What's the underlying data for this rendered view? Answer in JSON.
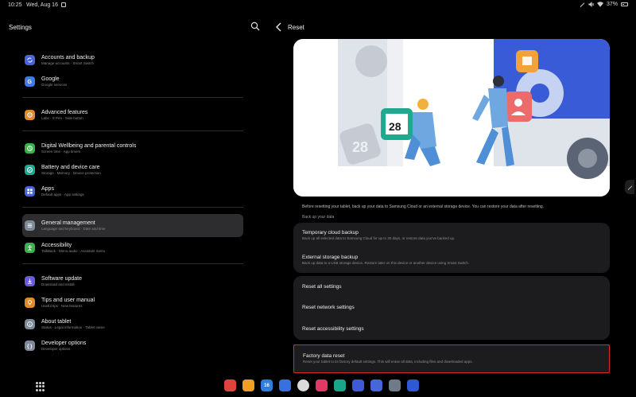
{
  "status_bar": {
    "time": "10:25",
    "date": "Wed, Aug 16",
    "battery": "37%"
  },
  "left": {
    "title": "Settings",
    "groups": [
      [
        {
          "title": "Accounts and backup",
          "sub": "Manage accounts · Smart Switch",
          "color": "#4a63d8",
          "icon": "sync-icon"
        },
        {
          "title": "Google",
          "sub": "Google services",
          "color": "#3d7be8",
          "icon": "google-icon"
        }
      ],
      [
        {
          "title": "Advanced features",
          "sub": "Labs · S Pen · Side button",
          "color": "#e08a2b",
          "icon": "star-gear-icon"
        }
      ],
      [
        {
          "title": "Digital Wellbeing and parental controls",
          "sub": "Screen time · App timers",
          "color": "#3bb14a",
          "icon": "wellbeing-icon"
        },
        {
          "title": "Battery and device care",
          "sub": "Storage · Memory · Device protection",
          "color": "#1fa98f",
          "icon": "device-care-icon"
        },
        {
          "title": "Apps",
          "sub": "Default apps · App settings",
          "color": "#4a63d8",
          "icon": "apps-icon"
        }
      ],
      [
        {
          "title": "General management",
          "sub": "Language and keyboard · Date and time",
          "color": "#7f8a98",
          "icon": "sliders-icon",
          "selected": true
        },
        {
          "title": "Accessibility",
          "sub": "TalkBack · Mono audio · Assistant menu",
          "color": "#3bb14a",
          "icon": "accessibility-icon"
        }
      ],
      [
        {
          "title": "Software update",
          "sub": "Download and install",
          "color": "#6a5adf",
          "icon": "update-icon"
        },
        {
          "title": "Tips and user manual",
          "sub": "Useful tips · New features",
          "color": "#e08a2b",
          "icon": "tips-icon"
        },
        {
          "title": "About tablet",
          "sub": "Status · Legal information · Tablet name",
          "color": "#7f8a98",
          "icon": "info-icon"
        },
        {
          "title": "Developer options",
          "sub": "Developer options",
          "color": "#7f8a98",
          "icon": "braces-icon"
        }
      ]
    ]
  },
  "right": {
    "title": "Reset",
    "description": "Before resetting your tablet, back up your data to Samsung Cloud or an external storage device. You can restore your data after resetting.",
    "section_label": "Back up your data",
    "backup_rows": [
      {
        "title": "Temporary cloud backup",
        "sub": "Back up all selected data to Samsung Cloud for up to 30 days, or restore data you've backed up."
      },
      {
        "title": "External storage backup",
        "sub": "Back up data to a USB storage device. Restore later on this device or another device using Smart Switch."
      }
    ],
    "reset_rows": [
      {
        "title": "Reset all settings"
      },
      {
        "title": "Reset network settings"
      },
      {
        "title": "Reset accessibility settings"
      }
    ],
    "factory": {
      "title": "Factory data reset",
      "sub": "Reset your tablet to its factory default settings. This will erase all data, including files and downloaded apps."
    },
    "illustration": {
      "calendar_day": "28",
      "calendar_day_2": "28"
    }
  },
  "taskbar": {
    "apps": [
      {
        "name": "notes-app-icon",
        "color": "#e0433b",
        "label": ""
      },
      {
        "name": "my-files-icon",
        "color": "#f0a020",
        "label": ""
      },
      {
        "name": "calendar-app-icon",
        "color": "#2f7de1",
        "label": "16"
      },
      {
        "name": "messages-app-icon",
        "color": "#3a6fe0",
        "label": ""
      },
      {
        "name": "chrome-app-icon",
        "color": "#dadada",
        "label": ""
      },
      {
        "name": "screen-recorder-icon",
        "color": "#e03a64",
        "label": ""
      },
      {
        "name": "notes-teal-icon",
        "color": "#18a58a",
        "label": ""
      },
      {
        "name": "kids-app-icon",
        "color": "#3f5ad6",
        "label": ""
      },
      {
        "name": "galaxy-apps-icon",
        "color": "#4667d9",
        "label": ""
      },
      {
        "name": "settings-app-icon",
        "color": "#6f7b88",
        "label": ""
      },
      {
        "name": "store-app-icon",
        "color": "#2e58d6",
        "label": ""
      }
    ]
  }
}
